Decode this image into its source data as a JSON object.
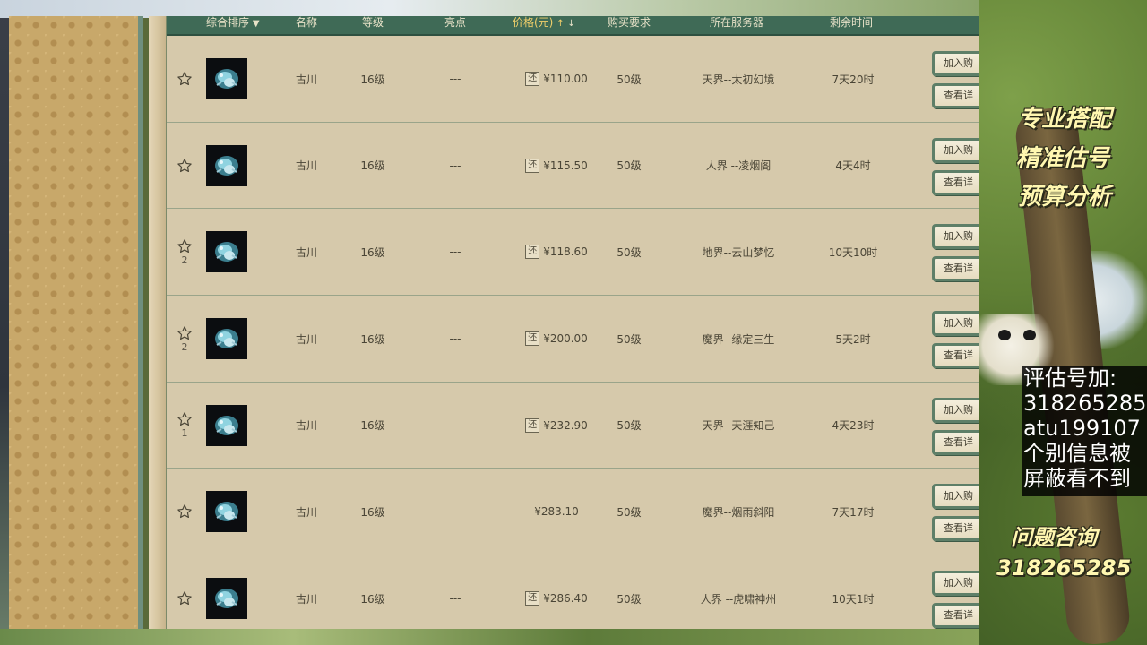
{
  "table": {
    "headers": {
      "sort": "综合排序",
      "name": "名称",
      "level": "等级",
      "highlight": "亮点",
      "price": "价格(元)",
      "requirement": "购买要求",
      "server": "所在服务器",
      "remaining": "剩余时间"
    },
    "rows": [
      {
        "fav_count": "",
        "name": "古川",
        "level": "16级",
        "highlight": "---",
        "tag": "还",
        "price": "¥110.00",
        "requirement": "50级",
        "server": "天界--太初幻境",
        "remaining": "7天20时",
        "add_label": "加入购",
        "view_label": "查看详"
      },
      {
        "fav_count": "",
        "name": "古川",
        "level": "16级",
        "highlight": "---",
        "tag": "还",
        "price": "¥115.50",
        "requirement": "50级",
        "server": "人界 --凌烟阁",
        "remaining": "4天4时",
        "add_label": "加入购",
        "view_label": "查看详"
      },
      {
        "fav_count": "2",
        "name": "古川",
        "level": "16级",
        "highlight": "---",
        "tag": "还",
        "price": "¥118.60",
        "requirement": "50级",
        "server": "地界--云山梦忆",
        "remaining": "10天10时",
        "add_label": "加入购",
        "view_label": "查看详"
      },
      {
        "fav_count": "2",
        "name": "古川",
        "level": "16级",
        "highlight": "---",
        "tag": "还",
        "price": "¥200.00",
        "requirement": "50级",
        "server": "魔界--缘定三生",
        "remaining": "5天2时",
        "add_label": "加入购",
        "view_label": "查看详"
      },
      {
        "fav_count": "1",
        "name": "古川",
        "level": "16级",
        "highlight": "---",
        "tag": "还",
        "price": "¥232.90",
        "requirement": "50级",
        "server": "天界--天涯知己",
        "remaining": "4天23时",
        "add_label": "加入购",
        "view_label": "查看详"
      },
      {
        "fav_count": "",
        "name": "古川",
        "level": "16级",
        "highlight": "---",
        "tag": "",
        "price": "¥283.10",
        "requirement": "50级",
        "server": "魔界--烟雨斜阳",
        "remaining": "7天17时",
        "add_label": "加入购",
        "view_label": "查看详"
      },
      {
        "fav_count": "",
        "name": "古川",
        "level": "16级",
        "highlight": "---",
        "tag": "还",
        "price": "¥286.40",
        "requirement": "50级",
        "server": "人界 --虎啸神州",
        "remaining": "10天1时",
        "add_label": "加入购",
        "view_label": "查看详"
      }
    ]
  },
  "promo": {
    "line1": "专业搭配",
    "line2": "精准估号",
    "line3": "预算分析",
    "contact_lines": [
      "评估号加:",
      "318265285",
      "atu199107",
      "个别信息被",
      "屏蔽看不到"
    ],
    "question_label": "问题咨询",
    "question_number": "318265285"
  },
  "colors": {
    "header_bg": "#3f6a56",
    "price_header": "#f2d06a",
    "row_bg": "#d6c9ab",
    "button_border": "#5e7f68",
    "promo_text": "#fff7b0"
  },
  "icons": {
    "favorite": "star-outline-icon",
    "item_thumbnail": "pet-thumbnail-icon",
    "sort_down": "triangle-down-icon",
    "price_up": "arrow-up-icon",
    "price_down": "arrow-down-icon"
  }
}
